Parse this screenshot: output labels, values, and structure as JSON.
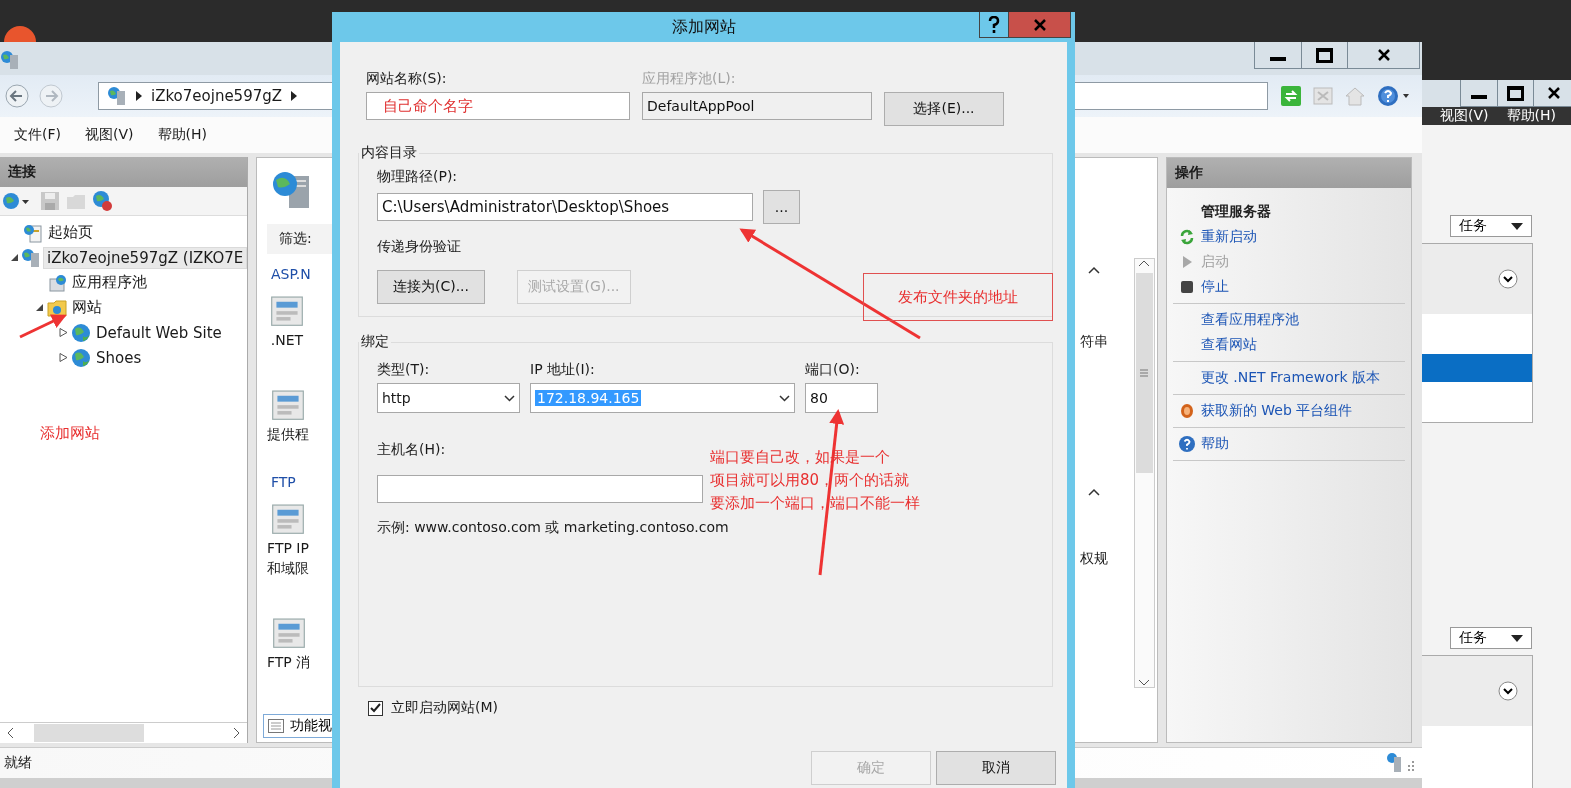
{
  "iis_window": {
    "address_path": "iZko7eojne597gZ",
    "menu": [
      "文件(F)",
      "视图(V)",
      "帮助(H)"
    ],
    "connections": {
      "title": "连接",
      "tree": [
        {
          "kind": "start",
          "label": "起始页",
          "selected": false
        },
        {
          "kind": "server",
          "label": "iZko7eojne597gZ (IZKO7E",
          "selected": true,
          "expanded": true,
          "children": [
            {
              "kind": "pool",
              "label": "应用程序池",
              "selected": false
            },
            {
              "kind": "sites",
              "label": "网站",
              "selected": false,
              "expanded": true,
              "children": [
                {
                  "kind": "site",
                  "label": "Default Web Site",
                  "selected": false,
                  "expanded": false
                },
                {
                  "kind": "site",
                  "label": "Shoes",
                  "selected": false,
                  "expanded": false
                }
              ]
            }
          ]
        }
      ]
    },
    "center": {
      "filter_label": "筛选:",
      "left_items": [
        {
          "kind": "heading",
          "lines": [
            "ASP.N"
          ]
        },
        {
          "kind": "tile",
          "lines": [
            ".NET"
          ]
        },
        {
          "kind": "tile",
          "lines": [
            "提供程"
          ]
        },
        {
          "kind": "heading",
          "lines": [
            "FTP"
          ]
        },
        {
          "kind": "tile",
          "lines": [
            "FTP IP",
            "和域限"
          ]
        },
        {
          "kind": "tile",
          "lines": [
            "FTP 消"
          ]
        }
      ],
      "right_items": [
        "符串",
        "权规"
      ],
      "view_tab": "功能视"
    },
    "actions": {
      "title": "操作",
      "groups": [
        [
          {
            "kind": "heading",
            "label": "管理服务器",
            "disabled": false
          },
          {
            "kind": "restart",
            "label": "重新启动",
            "disabled": false
          },
          {
            "kind": "start",
            "label": "启动",
            "disabled": true
          },
          {
            "kind": "stop",
            "label": "停止",
            "disabled": false
          }
        ],
        [
          {
            "kind": "link",
            "label": "查看应用程序池",
            "disabled": false
          },
          {
            "kind": "link",
            "label": "查看网站",
            "disabled": false
          }
        ],
        [
          {
            "kind": "link",
            "label": "更改 .NET Framework 版本",
            "disabled": false
          }
        ],
        [
          {
            "kind": "download",
            "label": "获取新的 Web 平台组件",
            "disabled": false
          }
        ],
        [
          {
            "kind": "help",
            "label": "帮助",
            "disabled": false
          }
        ]
      ]
    },
    "status": "就绪"
  },
  "server_manager": {
    "menu": [
      "视图(V)",
      "帮助(H)"
    ],
    "task_buttons": [
      "任务",
      "任务"
    ]
  },
  "dialog": {
    "title": "添加网站",
    "site_name": {
      "label": "网站名称(S):",
      "value": "自己命个名字"
    },
    "app_pool": {
      "label": "应用程序池(L):",
      "value": "DefaultAppPool",
      "disabled": true
    },
    "select_button": "选择(E)...",
    "content_dir": {
      "title": "内容目录",
      "path_label": "物理路径(P):",
      "path": "C:\\Users\\Administrator\\Desktop\\Shoes",
      "browse_button": "...",
      "auth_label": "传递身份验证",
      "connect_button": {
        "label": "连接为(C)...",
        "disabled": false
      },
      "test_button": {
        "label": "测试设置(G)...",
        "disabled": true
      }
    },
    "binding": {
      "title": "绑定",
      "type_label": "类型(T):",
      "type": "http",
      "ip_label": "IP 地址(I):",
      "ip": "172.18.94.165",
      "port_label": "端口(O):",
      "port": "80",
      "host_label": "主机名(H):",
      "example": "示例: www.contoso.com 或 marketing.contoso.com"
    },
    "start_now": {
      "label": "立即启动网站(M)",
      "checked": true
    },
    "buttons": [
      {
        "label": "确定",
        "disabled": true
      },
      {
        "label": "取消",
        "disabled": false
      }
    ]
  },
  "annotations": [
    {
      "kind": "boxed",
      "lines": [
        "发布文件夹的地址"
      ]
    },
    {
      "kind": "plain",
      "lines": [
        "添加网站"
      ]
    },
    {
      "kind": "note",
      "lines": [
        "端口要自己改，如果是一个",
        "项目就可以用80，两个的话就",
        "要添加一个端口，端口不能一样"
      ]
    }
  ]
}
